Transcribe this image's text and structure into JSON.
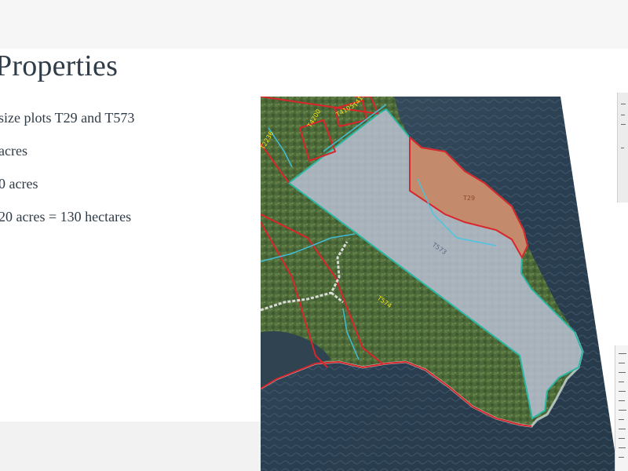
{
  "slide": {
    "title": "Properties",
    "bullets": [
      "size plots T29 and T573",
      "acres",
      "0 acres",
      "20 acres = 130 hectares"
    ]
  },
  "map": {
    "labels": {
      "t29": "T29",
      "t573": "T573",
      "t574": "T574",
      "t2236": "T2236",
      "t4200": "T4200",
      "t4105": "T4105",
      "t4104": "T4104"
    },
    "colors": {
      "t573_fill": "#b9bfd4",
      "t29_fill": "#c9825e",
      "boundary_red": "#d8262b",
      "boundary_teal": "#2bb6a3",
      "stream_cyan": "#3fc6e8",
      "road_white": "#e8e8e8",
      "label_yellow": "#f2e318"
    }
  }
}
